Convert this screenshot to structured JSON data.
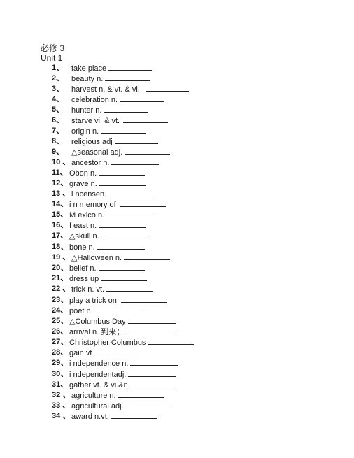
{
  "document": {
    "title": "必修 3",
    "unit": "Unit 1",
    "items": [
      {
        "num": "1、",
        "term": "take place",
        "blank_width": 62
      },
      {
        "num": "2、",
        "term": "beauty  n.",
        "blank_width": 64
      },
      {
        "num": "3、",
        "term": "harvest n. & vt. & vi.",
        "blank_width": 62,
        "gap": 8
      },
      {
        "num": "4、",
        "term": "celebration  n.",
        "blank_width": 64
      },
      {
        "num": "5、",
        "term": "hunter n.",
        "blank_width": 64
      },
      {
        "num": "6、",
        "term": "starve vi. & vt.",
        "blank_width": 64,
        "gap": 5
      },
      {
        "num": "7、",
        "term": "origin   n.",
        "blank_width": 64
      },
      {
        "num": "8、",
        "term": "religious  adj",
        "blank_width": 62
      },
      {
        "num": "9、",
        "term": "△seasonal adj.",
        "blank_width": 64,
        "gap": 4
      },
      {
        "num": "10 、",
        "term": "ancestor n.",
        "blank_width": 68
      },
      {
        "num": "11、",
        "term": "Obon  n.",
        "blank_width": 66
      },
      {
        "num": "12、",
        "term": "grave  n.",
        "blank_width": 66,
        "thick": true
      },
      {
        "num": "13 、",
        "term": "i ncensen.",
        "blank_width": 66
      },
      {
        "num": "14、",
        "term": "i n memory of",
        "blank_width": 66,
        "gap": 5,
        "thick": true
      },
      {
        "num": "15、",
        "term": "M exico  n.",
        "blank_width": 66
      },
      {
        "num": "16、",
        "term": "f east n.",
        "blank_width": 68
      },
      {
        "num": "17、",
        "term": "△skull   n.",
        "blank_width": 66
      },
      {
        "num": "18、",
        "term": "bone  n.",
        "blank_width": 68
      },
      {
        "num": "19 、",
        "term": "△Halloween  n.",
        "blank_width": 66
      },
      {
        "num": "20、",
        "term": "belief   n.",
        "blank_width": 66
      },
      {
        "num": "21、",
        "term": "dress up",
        "blank_width": 66
      },
      {
        "num": "22 、",
        "term": "trick  n. vt.",
        "blank_width": 66
      },
      {
        "num": "23、",
        "term": "play a trick on",
        "blank_width": 66,
        "gap": 6
      },
      {
        "num": "24、",
        "term": "poet  n.",
        "blank_width": 68
      },
      {
        "num": "25、",
        "term": "△Columbus Day",
        "blank_width": 68
      },
      {
        "num": "26、",
        "term": "arrival   n. 到来；",
        "blank_width": 68,
        "gap": 6
      },
      {
        "num": "27、",
        "term": "Christopher Columbus",
        "blank_width": 66
      },
      {
        "num": "28、",
        "term": "gain vt",
        "blank_width": 66
      },
      {
        "num": "29、",
        "term": "i ndependence n.",
        "blank_width": 68
      },
      {
        "num": "30、",
        "term": "i ndependentadj.",
        "blank_width": 68
      },
      {
        "num": "31、",
        "term": "gather vt. & vi.&n",
        "blank_width": 64,
        "suffix": "."
      },
      {
        "num": "32 、",
        "term": "agriculture  n.",
        "blank_width": 66
      },
      {
        "num": "33 、",
        "term": "agricultural  adj.",
        "blank_width": 66
      },
      {
        "num": "34 、",
        "term": "award n.vt.",
        "blank_width": 66
      }
    ]
  }
}
